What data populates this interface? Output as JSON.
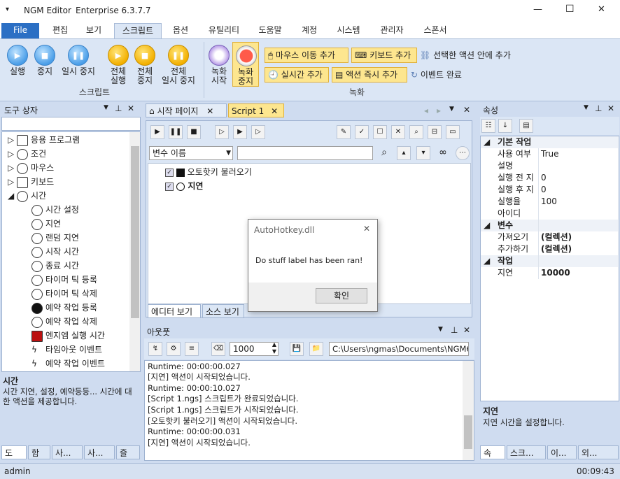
{
  "window": {
    "title": "NGM Editor",
    "edition": "Enterprise 6.3.7.7",
    "min": "—",
    "max": "☐",
    "close": "✕"
  },
  "ribbon_tabs": [
    {
      "label": "File"
    },
    {
      "label": "편집"
    },
    {
      "label": "보기"
    },
    {
      "label": "스크립트"
    },
    {
      "label": "옵션"
    },
    {
      "label": "유틸리티"
    },
    {
      "label": "도움말"
    },
    {
      "label": "계정"
    },
    {
      "label": "시스템"
    },
    {
      "label": "관리자"
    },
    {
      "label": "스폰서"
    }
  ],
  "script_group": {
    "run": "실행",
    "stop": "중지",
    "pause": "일시 중지",
    "run_all_1": "전체",
    "run_all_2": "실행",
    "stop_all_1": "전체",
    "stop_all_2": "중지",
    "pause_all_1": "전체",
    "pause_all_2": "일시 중지",
    "label": "스크립트"
  },
  "record_group": {
    "rec1": "녹화",
    "rec2": "시작",
    "stop1": "녹화",
    "stop2": "중지",
    "add_mouse": "마우스 이동 추가",
    "add_key": "키보드 추가",
    "add_in": "선택한 액션 안에 추가",
    "add_time": "실시간 추가",
    "add_now": "액션 즉시 추가",
    "event_done": "이벤트 완료",
    "label": "녹화"
  },
  "toolbox": {
    "title": "도구 상자",
    "items": [
      {
        "label": "응용 프로그램"
      },
      {
        "label": "조건"
      },
      {
        "label": "마우스"
      },
      {
        "label": "키보드"
      },
      {
        "label": "시간"
      }
    ],
    "sub": [
      {
        "label": "시간 설정"
      },
      {
        "label": "지연"
      },
      {
        "label": "랜덤 지연"
      },
      {
        "label": "시작 시간"
      },
      {
        "label": "종료 시간"
      },
      {
        "label": "타이머 틱 등록"
      },
      {
        "label": "타이머 틱 삭제"
      },
      {
        "label": "예약 작업 등록"
      },
      {
        "label": "예약 작업 삭제"
      },
      {
        "label": "엔지엠 실행 시간"
      },
      {
        "label": "타임아웃 이벤트"
      },
      {
        "label": "예약 작업 이벤트"
      }
    ],
    "desc_title": "시간",
    "desc": "시간 지연, 설정, 예약등등... 시간에 대한 액션을 제공합니다.",
    "tabs": [
      "도",
      "함",
      "사...",
      "사...",
      "즐"
    ]
  },
  "doc_tabs": {
    "start": "시작 페이지",
    "script": "Script 1"
  },
  "editor": {
    "var_select": "변수 이름",
    "actions": [
      {
        "label": "오토핫키 불러오기"
      },
      {
        "label": "지연"
      }
    ],
    "tab_editor": "에디터 보기",
    "tab_source": "소스 보기"
  },
  "dialog": {
    "title": "AutoHotkey.dll",
    "message": "Do stuff label has been ran!",
    "ok": "확인"
  },
  "output": {
    "title": "아웃풋",
    "count": "1000",
    "path": "C:\\Users\\ngmas\\Documents\\NGM6\\",
    "lines": [
      "Runtime: 00:00:00.027",
      "[지연] 액션이 시작되었습니다.",
      "Runtime: 00:00:10.027",
      "[Script 1.ngs] 스크립트가 완료되었습니다.",
      "[Script 1.ngs] 스크립트가 시작되었습니다.",
      "[오토핫키 불러오기] 액션이 시작되었습니다.",
      "Runtime: 00:00:00.031",
      "[지연] 액션이 시작되었습니다."
    ]
  },
  "props": {
    "title": "속성",
    "sections": [
      {
        "h": "기본 작업"
      },
      {
        "h": "변수"
      },
      {
        "h": "작업"
      }
    ],
    "rows": [
      {
        "k": "사용 여부",
        "v": "True"
      },
      {
        "k": "설명",
        "v": ""
      },
      {
        "k": "실행 전 지",
        "v": "0"
      },
      {
        "k": "실행 후 지",
        "v": "0"
      },
      {
        "k": "실행율",
        "v": "100"
      },
      {
        "k": "아이디",
        "v": ""
      },
      {
        "k": "가져오기",
        "v": "(컬렉션)"
      },
      {
        "k": "추가하기",
        "v": "(컬렉션)"
      },
      {
        "k": "지연",
        "v": "10000"
      }
    ],
    "desc_title": "지연",
    "desc": "지연 시간을 설정합니다.",
    "tabs": [
      "속",
      "스크...",
      "이...",
      "외..."
    ]
  },
  "status": {
    "user": "admin",
    "time": "00:09:43"
  }
}
